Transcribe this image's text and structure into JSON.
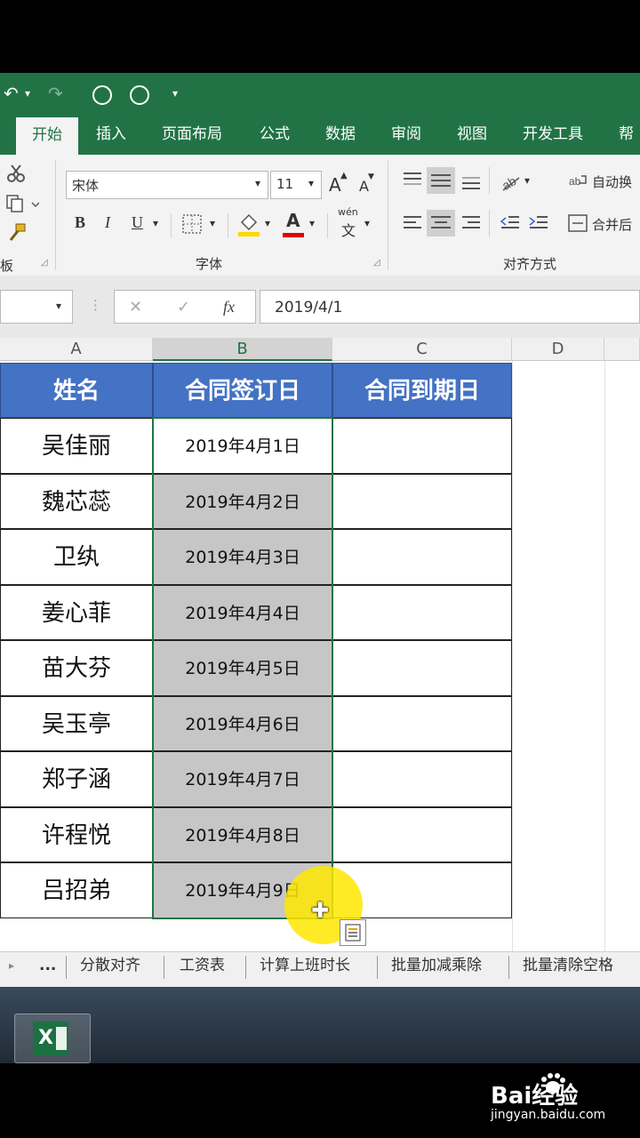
{
  "qat": {
    "undo": "↶",
    "undo_dd": "▾",
    "redo": "↷",
    "customize": "▾"
  },
  "tabs": [
    {
      "label": "开始"
    },
    {
      "label": "插入"
    },
    {
      "label": "页面布局"
    },
    {
      "label": "公式"
    },
    {
      "label": "数据"
    },
    {
      "label": "审阅"
    },
    {
      "label": "视图"
    },
    {
      "label": "开发工具"
    },
    {
      "label": "帮"
    }
  ],
  "ribbon": {
    "font_name": "宋体",
    "font_size": "11",
    "grow_font": "A",
    "shrink_font": "A",
    "bold": "B",
    "italic": "I",
    "underline": "U",
    "font_color_glyph": "A",
    "phonetic_top": "wén",
    "phonetic_bottom": "文",
    "wrap_text": "自动换",
    "merge": "合并后",
    "group_font": "字体",
    "group_align": "对齐方式",
    "group_clip_cut": "板",
    "colors": {
      "fill": "#ffd700",
      "font": "#e00000"
    }
  },
  "formula_bar": {
    "cancel": "✕",
    "enter": "✓",
    "fx": "fx",
    "value": "2019/4/1"
  },
  "grid": {
    "columns": [
      "A",
      "B",
      "C",
      "D"
    ],
    "headers": [
      "姓名",
      "合同签订日",
      "合同到期日"
    ],
    "rows": [
      {
        "name": "吴佳丽",
        "date": "2019年4月1日"
      },
      {
        "name": "魏芯蕊",
        "date": "2019年4月2日"
      },
      {
        "name": "卫纨",
        "date": "2019年4月3日"
      },
      {
        "name": "姜心菲",
        "date": "2019年4月4日"
      },
      {
        "name": "苗大芬",
        "date": "2019年4月5日"
      },
      {
        "name": "吴玉亭",
        "date": "2019年4月6日"
      },
      {
        "name": "郑子涵",
        "date": "2019年4月7日"
      },
      {
        "name": "许程悦",
        "date": "2019年4月8日"
      },
      {
        "name": "吕招弟",
        "date": "2019年4月9日"
      }
    ]
  },
  "sheets": [
    "...",
    "分散对齐",
    "工资表",
    "计算上班时长",
    "批量加减乘除",
    "批量清除空格"
  ],
  "taskbar": {
    "excel_letter": "X"
  },
  "watermark": {
    "brand": "Bai经验",
    "url": "jingyan.baidu.com"
  }
}
